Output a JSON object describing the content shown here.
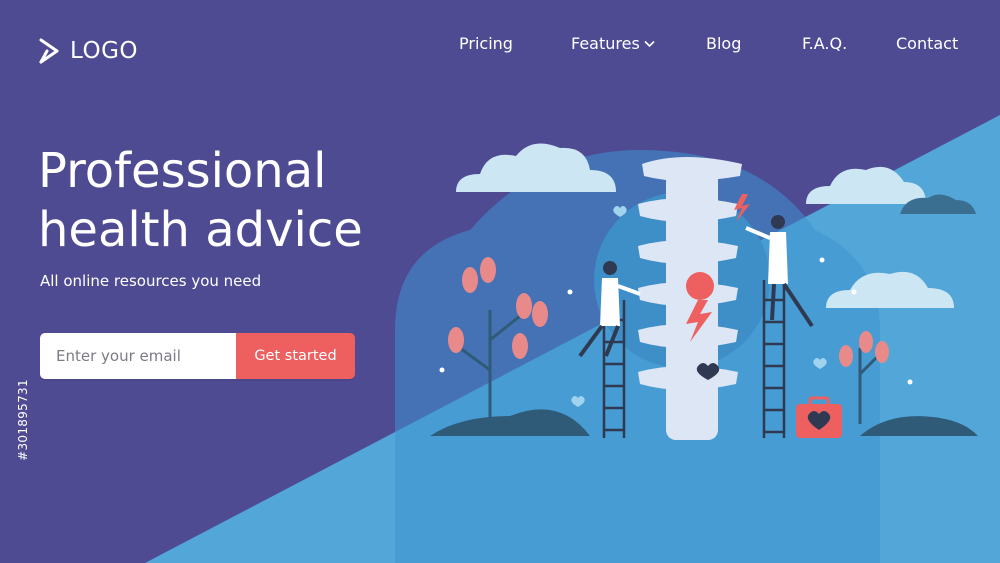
{
  "header": {
    "logo_text": "LOGO",
    "nav": [
      {
        "label": "Pricing"
      },
      {
        "label": "Features",
        "has_dropdown": true
      },
      {
        "label": "Blog"
      },
      {
        "label": "F.A.Q."
      },
      {
        "label": "Contact"
      }
    ]
  },
  "hero": {
    "title_line1": "Professional",
    "title_line2": "health advice",
    "subtitle": "All online resources you need"
  },
  "form": {
    "email_placeholder": "Enter your email",
    "cta_label": "Get started"
  },
  "stock_id": "#301895731",
  "colors": {
    "background": "#4e4b93",
    "panel": "#52a7d8",
    "cta": "#ee5f60",
    "cloud": "#cde6f4",
    "spine": "#dde6f5"
  },
  "icons": {
    "logo": "chevron-right-icon",
    "dropdown": "chevron-down-icon"
  }
}
